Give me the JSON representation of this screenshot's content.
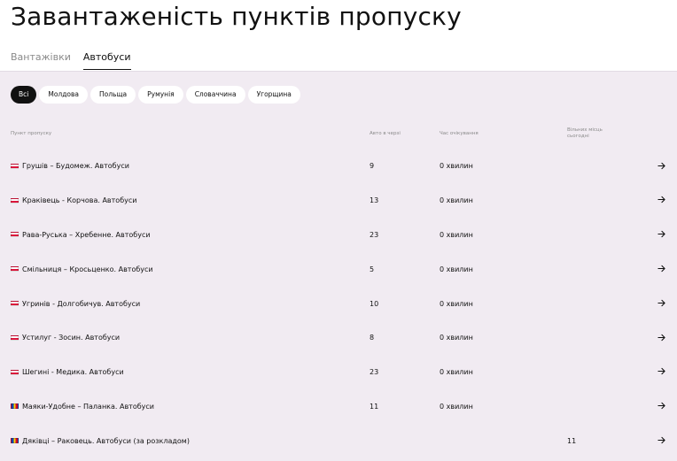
{
  "title": "Завантаженість пунктів пропуску",
  "tabs": [
    {
      "label": "Вантажівки",
      "active": false
    },
    {
      "label": "Автобуси",
      "active": true
    }
  ],
  "filters": [
    {
      "label": "Всі",
      "active": true
    },
    {
      "label": "Молдова",
      "active": false
    },
    {
      "label": "Польща",
      "active": false
    },
    {
      "label": "Румунія",
      "active": false
    },
    {
      "label": "Словаччина",
      "active": false
    },
    {
      "label": "Угорщина",
      "active": false
    }
  ],
  "columns": {
    "checkpoint": "Пункт пропуску",
    "queue": "Авто в черзі",
    "wait": "Час очікування",
    "free_slots_line1": "Вільних місць",
    "free_slots_line2": "сьогодні"
  },
  "colors": {
    "poland": [
      "#ffffff",
      "#dc143c"
    ],
    "moldova": [
      "#0046ae",
      "#ffd200",
      "#cc092f"
    ],
    "content_bg": "#f1ebf2"
  },
  "rows": [
    {
      "flag": "poland",
      "name": "Грушів – Будомеж. Автобуси",
      "queue": "9",
      "wait": "0 хвилин",
      "free": ""
    },
    {
      "flag": "poland",
      "name": "Краківець - Корчова. Автобуси",
      "queue": "13",
      "wait": "0 хвилин",
      "free": ""
    },
    {
      "flag": "poland",
      "name": "Рава-Руська – Хребенне. Автобуси",
      "queue": "23",
      "wait": "0 хвилин",
      "free": ""
    },
    {
      "flag": "poland",
      "name": "Смільниця – Кросьценко. Автобуси",
      "queue": "5",
      "wait": "0 хвилин",
      "free": ""
    },
    {
      "flag": "poland",
      "name": "Угринів - Долгобичув. Автобуси",
      "queue": "10",
      "wait": "0 хвилин",
      "free": ""
    },
    {
      "flag": "poland",
      "name": "Устилуг - Зосин. Автобуси",
      "queue": "8",
      "wait": "0 хвилин",
      "free": ""
    },
    {
      "flag": "poland",
      "name": "Шегині - Медика. Автобуси",
      "queue": "23",
      "wait": "0 хвилин",
      "free": ""
    },
    {
      "flag": "moldova",
      "name": "Маяки-Удобне – Паланка. Автобуси",
      "queue": "11",
      "wait": "0 хвилин",
      "free": ""
    },
    {
      "flag": "moldova",
      "name": "Дяківці – Раковець. Автобуси (за розкладом)",
      "queue": "",
      "wait": "",
      "free": "11"
    }
  ]
}
